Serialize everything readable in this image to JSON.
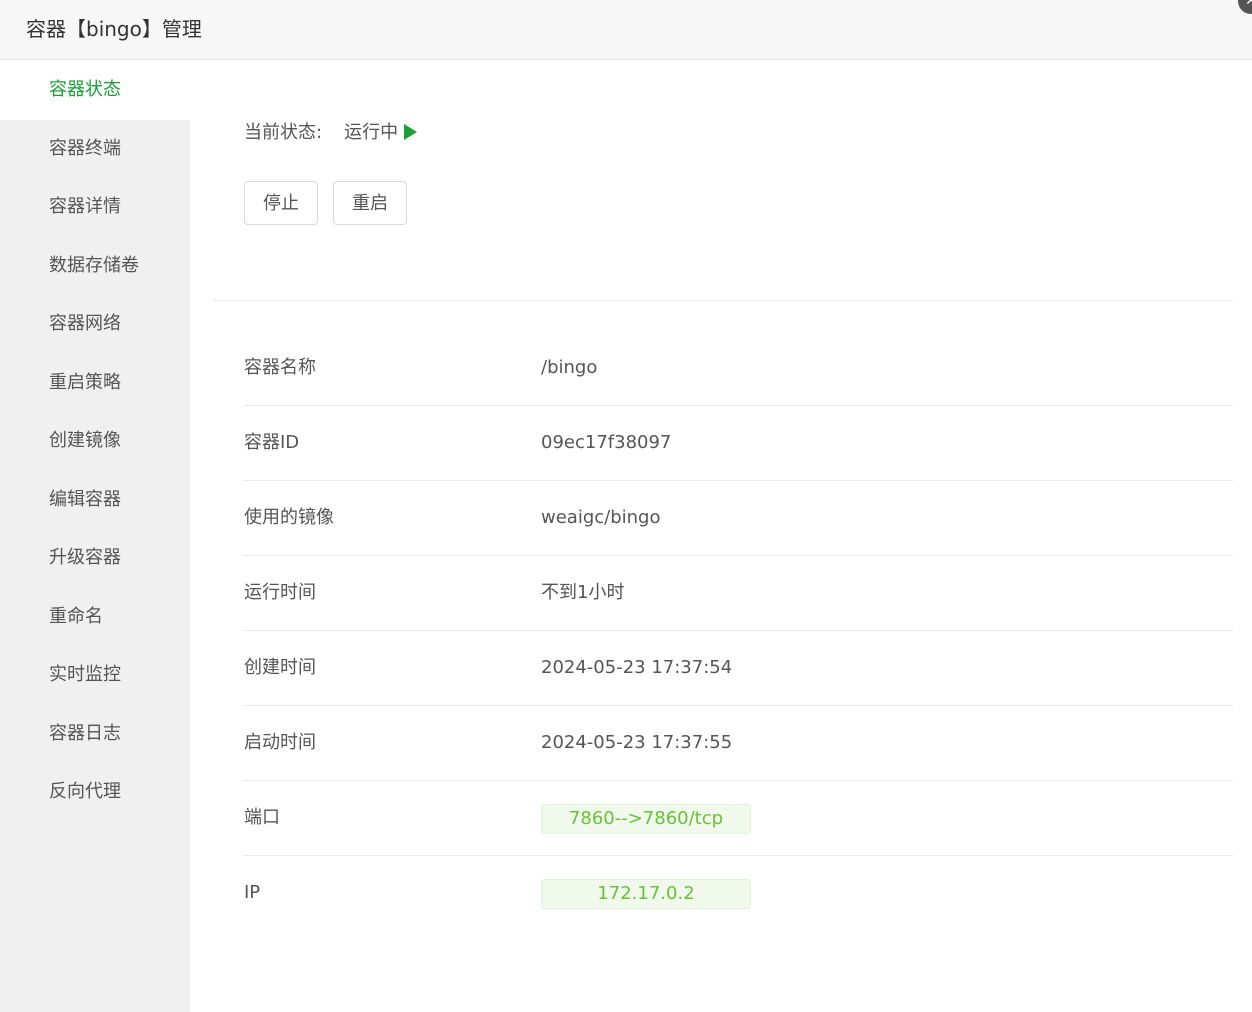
{
  "window": {
    "title": "容器【bingo】管理",
    "close_symbol": "✕"
  },
  "sidebar": {
    "items": [
      {
        "label": "容器状态",
        "active": true
      },
      {
        "label": "容器终端"
      },
      {
        "label": "容器详情"
      },
      {
        "label": "数据存储卷"
      },
      {
        "label": "容器网络"
      },
      {
        "label": "重启策略"
      },
      {
        "label": "创建镜像"
      },
      {
        "label": "编辑容器"
      },
      {
        "label": "升级容器"
      },
      {
        "label": "重命名"
      },
      {
        "label": "实时监控"
      },
      {
        "label": "容器日志"
      },
      {
        "label": "反向代理"
      }
    ]
  },
  "status": {
    "label": "当前状态:",
    "value": "运行中",
    "icon": "play-icon",
    "color": "#1aa035"
  },
  "actions": {
    "stop_label": "停止",
    "restart_label": "重启"
  },
  "info": {
    "name": {
      "label": "容器名称",
      "value": "/bingo"
    },
    "id": {
      "label": "容器ID",
      "value": "09ec17f38097"
    },
    "image": {
      "label": "使用的镜像",
      "value": "weaigc/bingo"
    },
    "uptime": {
      "label": "运行时间",
      "value": "不到1小时"
    },
    "created": {
      "label": "创建时间",
      "value": "2024-05-23 17:37:54"
    },
    "started": {
      "label": "启动时间",
      "value": "2024-05-23 17:37:55"
    },
    "ports": {
      "label": "端口",
      "value": "7860-->7860/tcp"
    },
    "ip": {
      "label": "IP",
      "value": "172.17.0.2"
    }
  },
  "colors": {
    "accent": "#1aa035",
    "badge_text": "#67c23a",
    "badge_bg": "#f0f9eb"
  }
}
